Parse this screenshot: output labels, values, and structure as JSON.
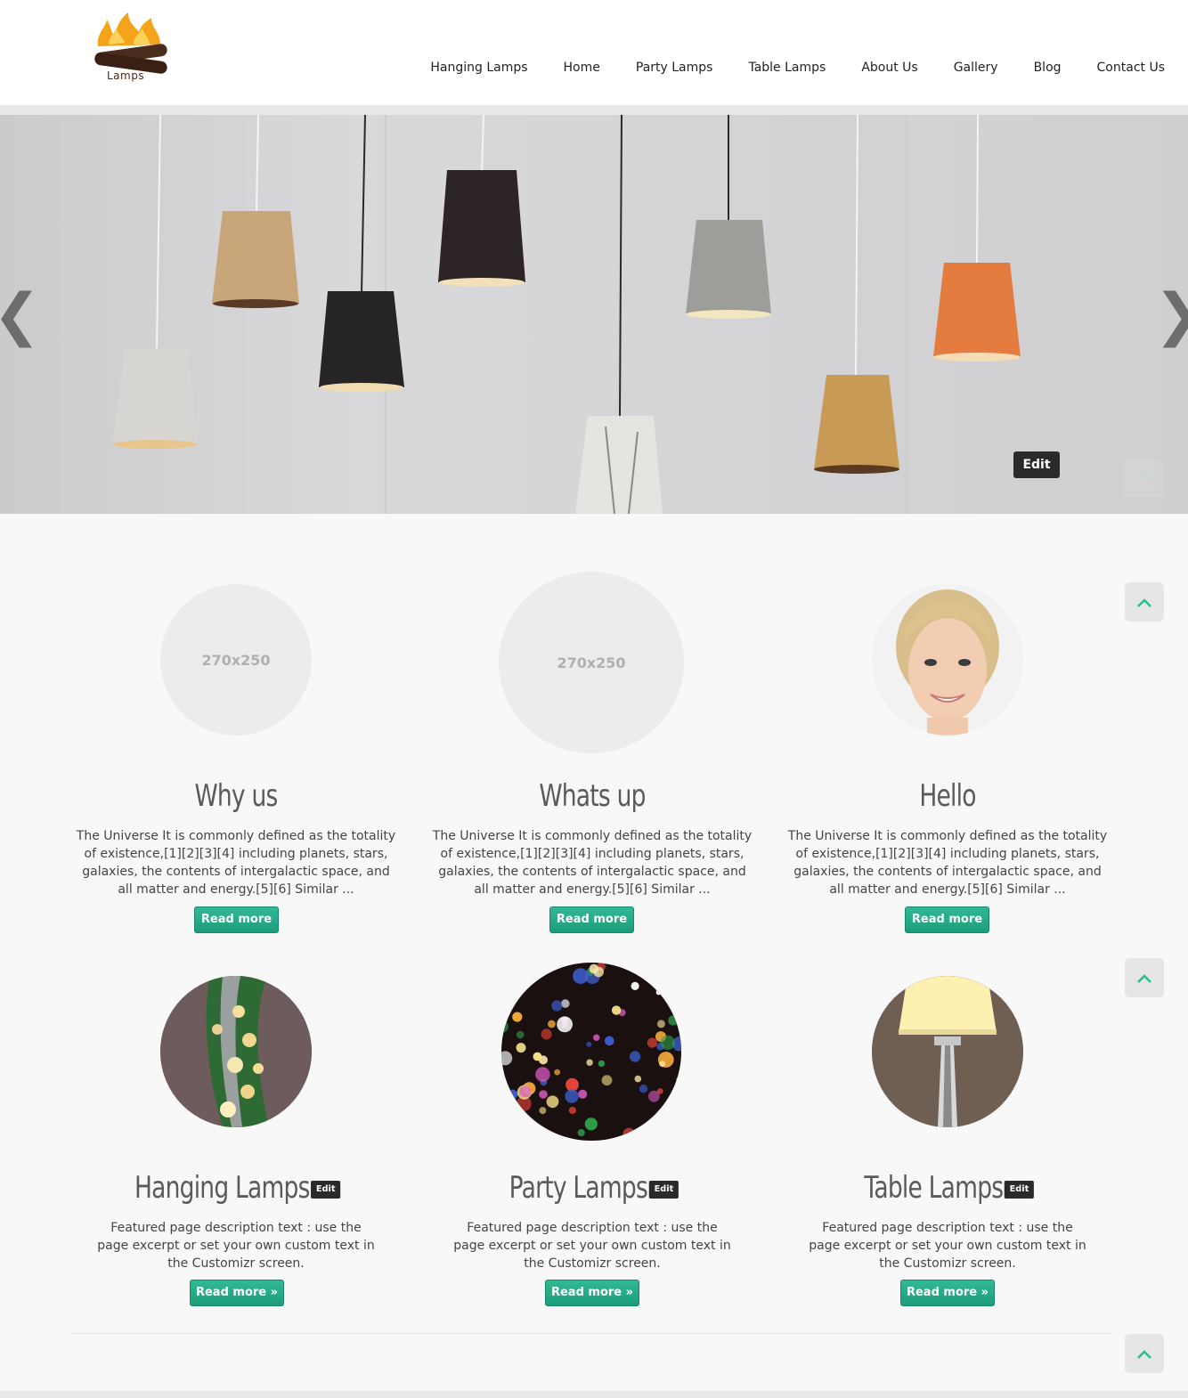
{
  "header": {
    "logo_text": "Lamps",
    "nav": [
      "Hanging Lamps",
      "Home",
      "Party Lamps",
      "Table Lamps",
      "About Us",
      "Gallery",
      "Blog",
      "Contact Us"
    ]
  },
  "slider": {
    "prev_icon": "❮",
    "next_icon": "❯",
    "edit_label": "Edit",
    "up_icon": "^"
  },
  "marketing": [
    {
      "placeholder": "270x250",
      "title": "Why us",
      "text": "The Universe It is commonly defined as the totality of existence,[1][2][3][4] including planets, stars, galaxies, the contents of intergalactic space, and all matter and energy.[5][6] Similar ...",
      "button": "Read more"
    },
    {
      "placeholder": "270x250",
      "title": "Whats up",
      "text": "The Universe It is commonly defined as the totality of existence,[1][2][3][4] including planets, stars, galaxies, the contents of intergalactic space, and all matter and energy.[5][6] Similar ...",
      "button": "Read more"
    },
    {
      "placeholder": "",
      "title": "Hello",
      "text": "The Universe It is commonly defined as the totality of existence,[1][2][3][4] including planets, stars, galaxies, the contents of intergalactic space, and all matter and energy.[5][6] Similar ...",
      "button": "Read more"
    }
  ],
  "featured": [
    {
      "title": "Hanging Lamps",
      "edit": "Edit",
      "text": "Featured page description text : use the page excerpt or set your own custom text in the Customizr screen.",
      "button": "Read more »"
    },
    {
      "title": "Party Lamps",
      "edit": "Edit",
      "text": "Featured page description text : use the page excerpt or set your own custom text in the Customizr screen.",
      "button": "Read more »"
    },
    {
      "title": "Table Lamps",
      "edit": "Edit",
      "text": "Featured page description text : use the page excerpt or set your own custom text in the Customizr screen.",
      "button": "Read more »"
    }
  ],
  "colors": {
    "accent": "#27a886",
    "up_icon": "#27c08a"
  }
}
